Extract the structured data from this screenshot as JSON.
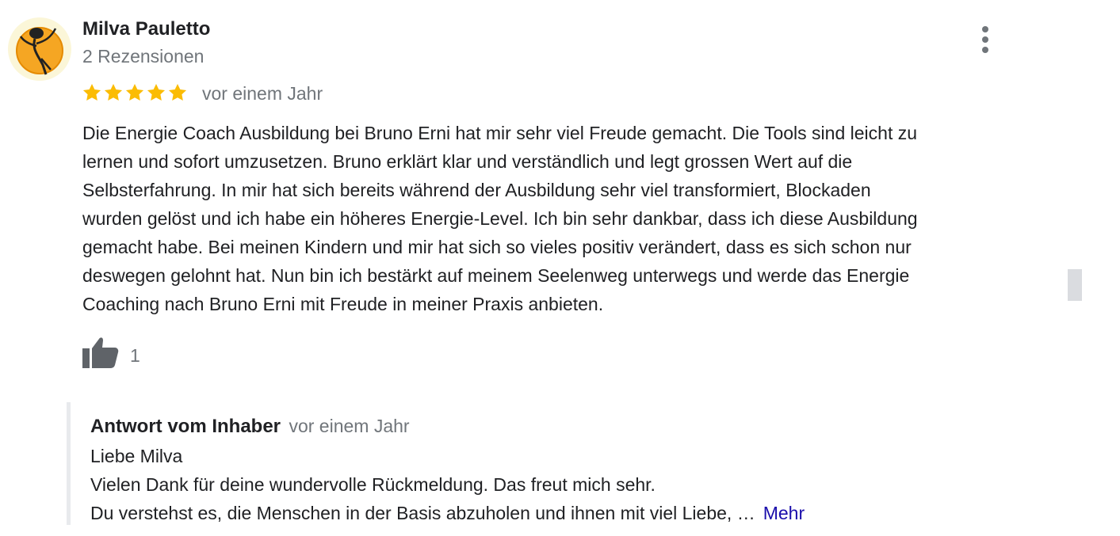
{
  "reviewer": {
    "name": "Milva Pauletto",
    "review_count": "2 Rezensionen"
  },
  "rating": {
    "stars": 5,
    "max": 5,
    "color": "#fbbc04"
  },
  "review": {
    "date": "vor einem Jahr",
    "text_lines": [
      "Die Energie Coach Ausbildung bei Bruno Erni hat mir sehr viel Freude gemacht. Die Tools sind leicht zu",
      "lernen und sofort umzusetzen. Bruno erklärt klar und verständlich und legt grossen Wert auf die",
      "Selbsterfahrung. In mir hat sich bereits während der Ausbildung sehr viel transformiert, Blockaden",
      "wurden gelöst und ich habe ein höheres Energie-Level. Ich bin sehr dankbar, dass ich diese Ausbildung",
      "gemacht habe. Bei meinen Kindern und mir hat sich so vieles positiv verändert, dass es sich schon nur",
      "deswegen gelohnt hat. Nun bin ich bestärkt auf meinem Seelenweg unterwegs und werde das Energie",
      "Coaching nach Bruno Erni mit Freude in meiner Praxis anbieten."
    ],
    "like_count": "1"
  },
  "owner_reply": {
    "label": "Antwort vom Inhaber",
    "date": "vor einem Jahr",
    "lines": [
      "Liebe Milva",
      "Vielen Dank für deine wundervolle Rückmeldung. Das freut mich sehr.",
      "Du verstehst es, die Menschen in der Basis abzuholen und ihnen mit viel Liebe, …"
    ],
    "more_label": "Mehr"
  },
  "icons": {
    "menu": "more-vert-icon",
    "like": "thumbs-up-icon",
    "star": "star-icon"
  }
}
